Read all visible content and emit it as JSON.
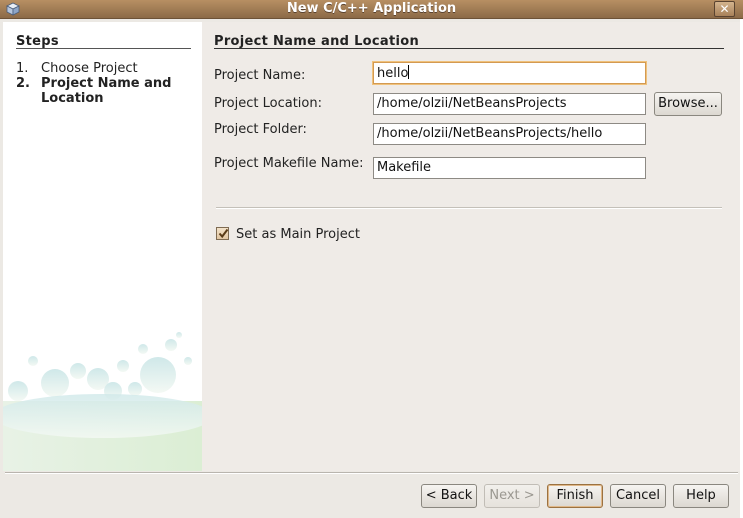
{
  "window": {
    "title": "New C/C++ Application",
    "close_glyph": "✕"
  },
  "steps": {
    "title": "Steps",
    "items": [
      {
        "num": "1.",
        "label": "Choose Project"
      },
      {
        "num": "2.",
        "label": "Project Name and Location"
      }
    ]
  },
  "form": {
    "section_title": "Project Name and Location",
    "project_name": {
      "label": "Project Name:",
      "value": "hello"
    },
    "project_location": {
      "label": "Project Location:",
      "value": "/home/olzii/NetBeansProjects"
    },
    "project_folder": {
      "label": "Project Folder:",
      "value": "/home/olzii/NetBeansProjects/hello"
    },
    "makefile_name": {
      "label": "Project Makefile Name:",
      "value": "Makefile"
    },
    "browse_label": "Browse...",
    "main_project": {
      "label": "Set as Main Project",
      "checked": true
    }
  },
  "buttons": {
    "back": "< Back",
    "next": "Next >",
    "finish": "Finish",
    "cancel": "Cancel",
    "help": "Help"
  },
  "icons": {
    "app": "netbeans-cube-icon",
    "close": "close-icon",
    "check": "checkmark-icon"
  },
  "colors": {
    "titlebar": "#a07a52",
    "focus_border": "#d39a52",
    "bubble": "#c8e4e6"
  }
}
